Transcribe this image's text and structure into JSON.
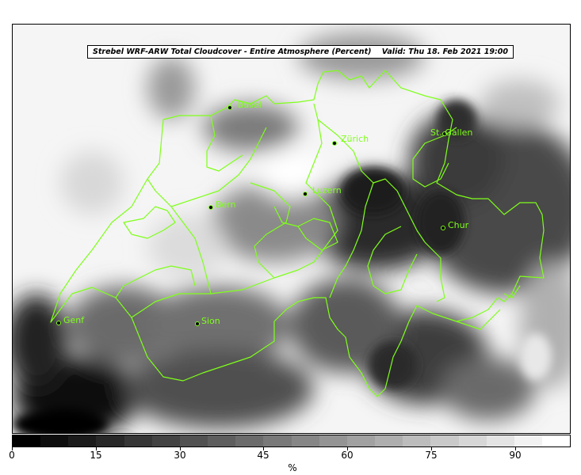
{
  "title": {
    "main": "Strebel WRF-ARW Total Cloudcover - Entire Atmosphere (Percent)",
    "valid": "Valid: Thu 18. Feb 2021 19:00"
  },
  "cities": [
    {
      "id": "basel",
      "name": "Basel"
    },
    {
      "id": "zurich",
      "name": "Zürich"
    },
    {
      "id": "st-gallen",
      "name": "St. Gallen"
    },
    {
      "id": "luzern",
      "name": "Luzern"
    },
    {
      "id": "bern",
      "name": "Bern"
    },
    {
      "id": "chur",
      "name": "Chur"
    },
    {
      "id": "genf",
      "name": "Genf"
    },
    {
      "id": "sion",
      "name": "Sion"
    }
  ],
  "colorbar": {
    "ticks": [
      "0",
      "15",
      "30",
      "45",
      "60",
      "75",
      "90"
    ],
    "unit": "%",
    "min": 0,
    "max": 100,
    "levels": 20
  },
  "colors": {
    "border_line": "#7fff1a",
    "city_label": "#7fff1a"
  }
}
